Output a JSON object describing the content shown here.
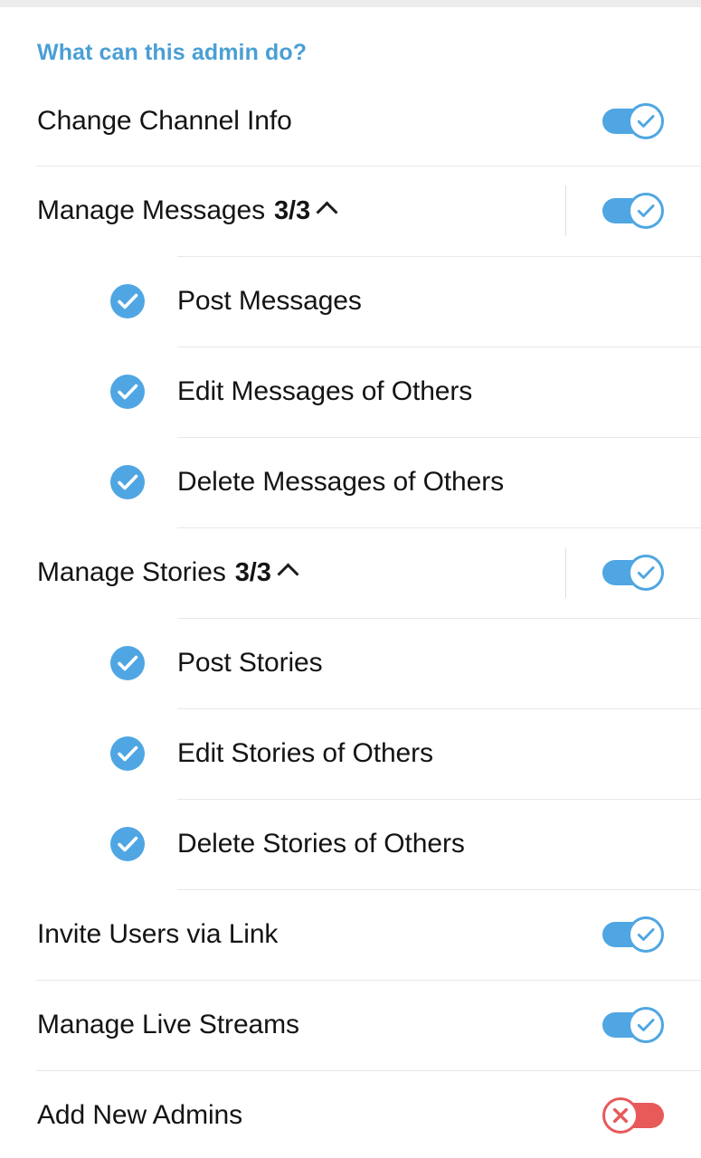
{
  "screen": {
    "title": "What can this admin do?",
    "accent_blue": "#4a9fd4",
    "toggle_on_color": "#4fa6e3",
    "toggle_off_color": "#e8595a",
    "text_color": "#141414",
    "divider_color": "#e8e8e8"
  },
  "permissions": [
    {
      "label": "Change Channel Info",
      "toggle": "on",
      "toggle_icon": "check-icon",
      "expandable": false,
      "count": "",
      "chevron": "",
      "children": []
    },
    {
      "label": "Manage Messages",
      "toggle": "on",
      "toggle_icon": "check-icon",
      "expandable": true,
      "count": "3/3",
      "chevron": "chevron-up-icon",
      "children": [
        {
          "label": "Post Messages",
          "checked": true,
          "icon": "check-circle-icon"
        },
        {
          "label": "Edit Messages of Others",
          "checked": true,
          "icon": "check-circle-icon"
        },
        {
          "label": "Delete Messages of Others",
          "checked": true,
          "icon": "check-circle-icon"
        }
      ]
    },
    {
      "label": "Manage Stories",
      "toggle": "on",
      "toggle_icon": "check-icon",
      "expandable": true,
      "count": "3/3",
      "chevron": "chevron-up-icon",
      "children": [
        {
          "label": "Post Stories",
          "checked": true,
          "icon": "check-circle-icon"
        },
        {
          "label": "Edit Stories of Others",
          "checked": true,
          "icon": "check-circle-icon"
        },
        {
          "label": "Delete Stories of Others",
          "checked": true,
          "icon": "check-circle-icon"
        }
      ]
    },
    {
      "label": "Invite Users via Link",
      "toggle": "on",
      "toggle_icon": "check-icon",
      "expandable": false,
      "count": "",
      "chevron": "",
      "children": []
    },
    {
      "label": "Manage Live Streams",
      "toggle": "on",
      "toggle_icon": "check-icon",
      "expandable": false,
      "count": "",
      "chevron": "",
      "children": []
    },
    {
      "label": "Add New Admins",
      "toggle": "off",
      "toggle_icon": "cross-icon",
      "expandable": false,
      "count": "",
      "chevron": "",
      "children": []
    }
  ]
}
